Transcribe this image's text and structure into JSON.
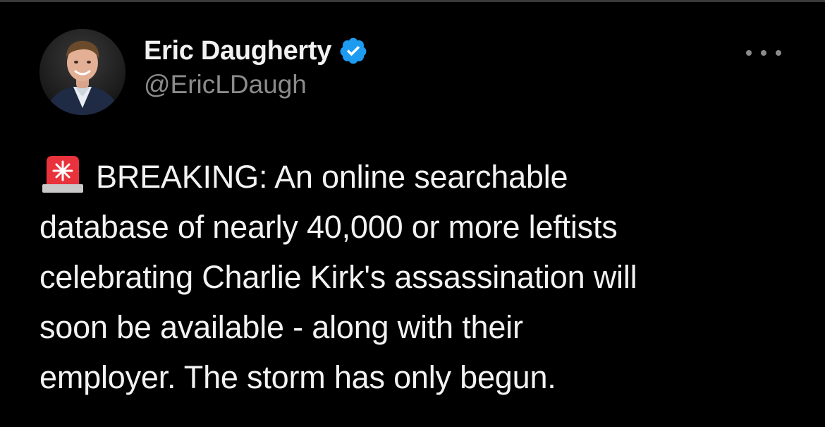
{
  "tweet": {
    "display_name": "Eric Daugherty",
    "handle": "@EricLDaugh",
    "verified": true,
    "verified_color": "#1d9bf0",
    "more_icon": "more-horizontal-icon",
    "emoji": "police-car-light-icon",
    "body_lines": [
      "BREAKING: An online searchable",
      "database of nearly 40,000 or more leftists",
      "celebrating Charlie Kirk's assassination will",
      "soon be available - along with their",
      "employer. The storm has only begun."
    ]
  }
}
